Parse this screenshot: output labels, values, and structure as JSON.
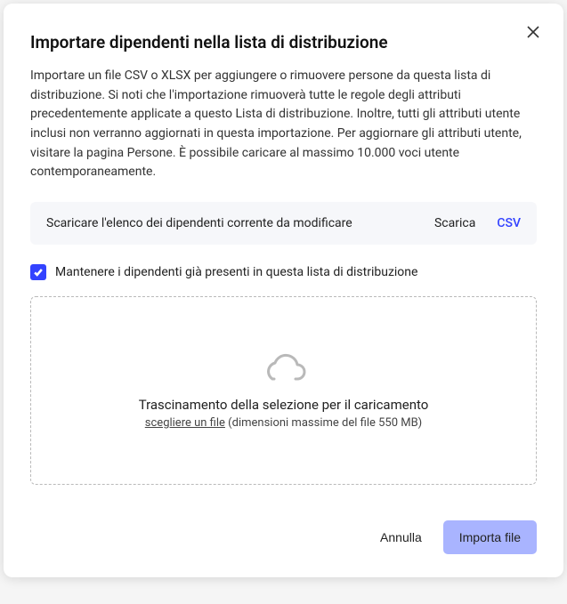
{
  "dialog": {
    "title": "Importare dipendenti nella lista di distribuzione",
    "description": "Importare un file CSV o XLSX per aggiungere o rimuovere persone da questa lista di distribuzione. Si noti che l'importazione rimuoverà tutte le regole degli attributi precedentemente applicate a questo Lista di distribuzione. Inoltre, tutti gli attributi utente inclusi non verranno aggiornati in questa importazione. Per aggiornare gli attributi utente, visitare la pagina Persone. È possibile caricare al massimo 10.000 voci utente contemporaneamente."
  },
  "download": {
    "label": "Scaricare l'elenco dei dipendenti corrente da modificare",
    "action": "Scarica",
    "format": "CSV"
  },
  "checkbox": {
    "checked": true,
    "label": "Mantenere i dipendenti già presenti in questa lista di distribuzione"
  },
  "dropzone": {
    "title": "Trascinamento della selezione per il caricamento",
    "choose_text": "scegliere un file",
    "size_hint": " (dimensioni massime del file 550 MB)"
  },
  "footer": {
    "cancel": "Annulla",
    "submit": "Importa file"
  },
  "colors": {
    "accent": "#3343ff",
    "primary_btn_bg": "#a9b4ff"
  }
}
